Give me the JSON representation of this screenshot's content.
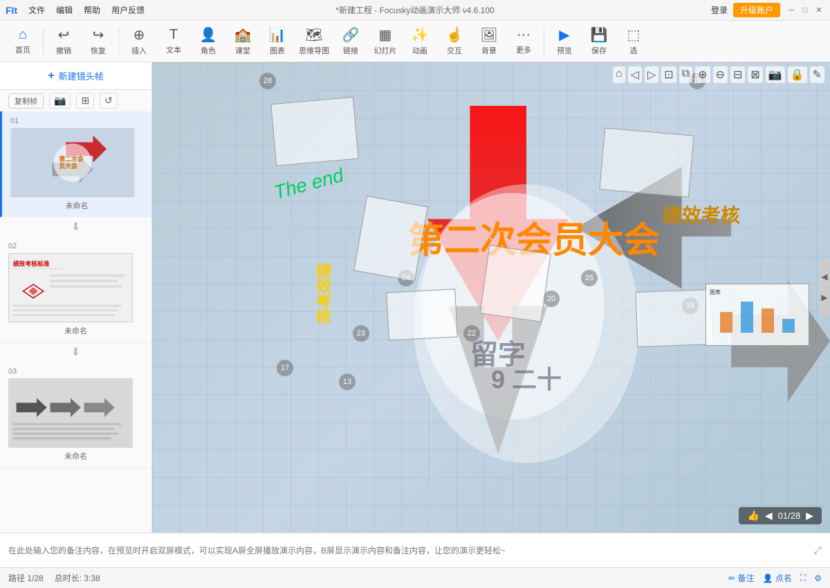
{
  "titlebar": {
    "menu_items": [
      "文件",
      "编辑",
      "帮助",
      "用户反馈"
    ],
    "title": "*新建工程 - Focusky动画演示大师 v4.6.100",
    "login": "登录",
    "upgrade": "升级账户",
    "win_min": "─",
    "win_max": "□",
    "win_close": "✕"
  },
  "toolbar": {
    "home": "首页",
    "undo": "撤销",
    "redo": "恢复",
    "insert": "插入",
    "text": "文本",
    "role": "角色",
    "classroom": "课堂",
    "chart": "图表",
    "mindmap": "思维导图",
    "link": "链接",
    "slide": "幻灯片",
    "animation": "动画",
    "interact": "交互",
    "background": "背景",
    "more": "更多",
    "preview": "预览",
    "save": "保存",
    "select": "选"
  },
  "sidebar": {
    "new_frame": "新建镜头帧",
    "frame_controls": [
      "复制帧",
      "📷",
      "⊞",
      "↺"
    ],
    "frames": [
      {
        "num": "01",
        "title": "未命名",
        "active": true
      },
      {
        "num": "02",
        "title": "未命名",
        "active": false
      },
      {
        "num": "03",
        "title": "未命名",
        "active": false
      }
    ]
  },
  "canvas": {
    "numbers": [
      "28",
      "19",
      "24",
      "25",
      "20",
      "23",
      "22",
      "16",
      "17",
      "13"
    ],
    "big_text": "第二次会员大会",
    "green_text": "The end",
    "gold_text": "绩效考核",
    "yellow_text": "绩效考核",
    "gray_text1": "留字",
    "gray_text2": "9 二十",
    "counter": "01/28"
  },
  "notes": {
    "placeholder": "在此处输入您的备注内容，在预览时开启双屏模式，可以实现A屏全屏播放演示内容，B屏显示演示内容和备注内容，让您的演示更轻松~"
  },
  "statusbar": {
    "path": "路径 1/28",
    "duration": "总时长: 3:38",
    "note_btn": "备注",
    "point_btn": "点名"
  }
}
